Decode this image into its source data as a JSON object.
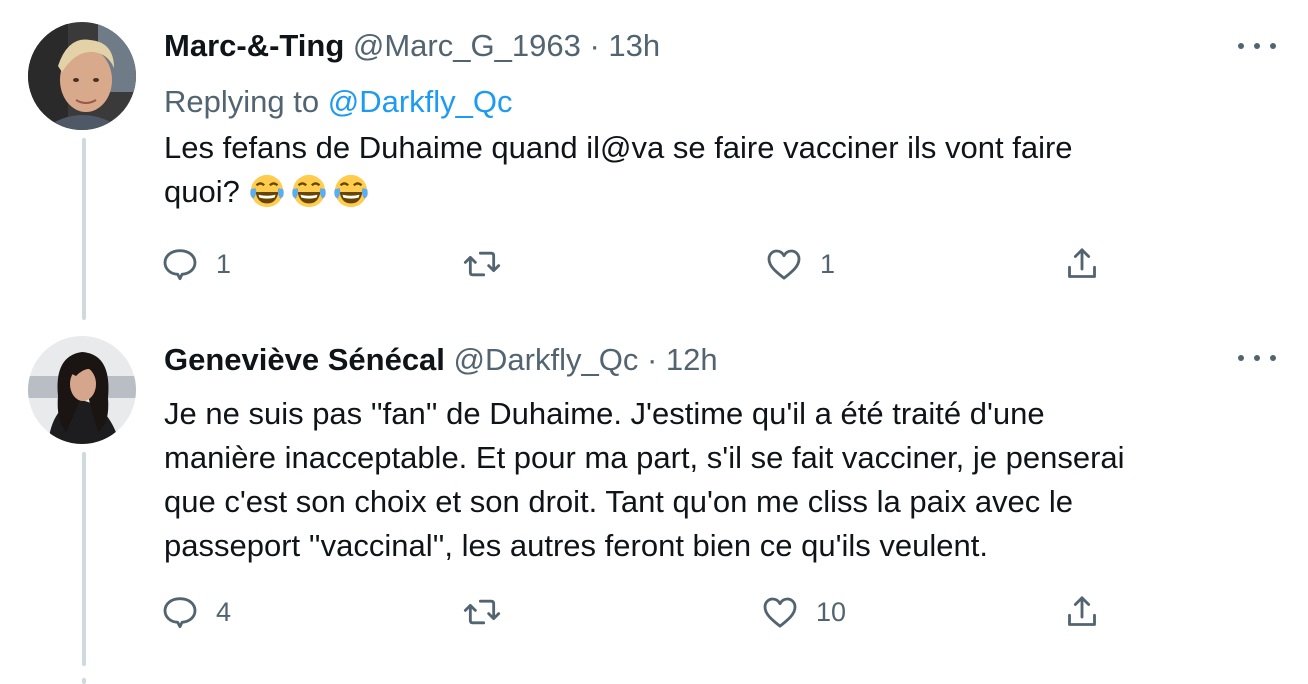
{
  "tweets": [
    {
      "display_name": "Marc-&-Ting",
      "handle": "@Marc_G_1963",
      "separator": "·",
      "time": "13h",
      "replying_prefix": "Replying to",
      "replying_to": "@Darkfly_Qc",
      "text_lines": [
        "Les fefans de Duhaime quand il@va se faire vacciner ils vont faire",
        "quoi?"
      ],
      "emojis": [
        "face-with-tears-of-joy",
        "face-with-tears-of-joy",
        "face-with-tears-of-joy"
      ],
      "reply_count": "1",
      "retweet_count": "",
      "like_count": "1"
    },
    {
      "display_name": "Geneviève Sénécal",
      "handle": "@Darkfly_Qc",
      "separator": "·",
      "time": "12h",
      "text_lines": [
        "Je ne suis pas ''fan'' de Duhaime. J'estime qu'il a été traité d'une",
        "manière inacceptable. Et pour ma part, s'il se fait vacciner, je penserai",
        "que c'est son choix et son droit. Tant qu'on me cliss la paix avec le",
        "passeport ''vaccinal'', les autres feront bien ce qu'ils veulent."
      ],
      "reply_count": "4",
      "retweet_count": "",
      "like_count": "10"
    }
  ],
  "icons": {
    "reply": "reply-icon",
    "retweet": "retweet-icon",
    "like": "like-icon",
    "share": "share-icon",
    "more": "more-options-icon"
  },
  "colors": {
    "text": "#0f1419",
    "secondary": "#536471",
    "link": "#1d9bf0",
    "thread_line": "#cfd9de"
  }
}
